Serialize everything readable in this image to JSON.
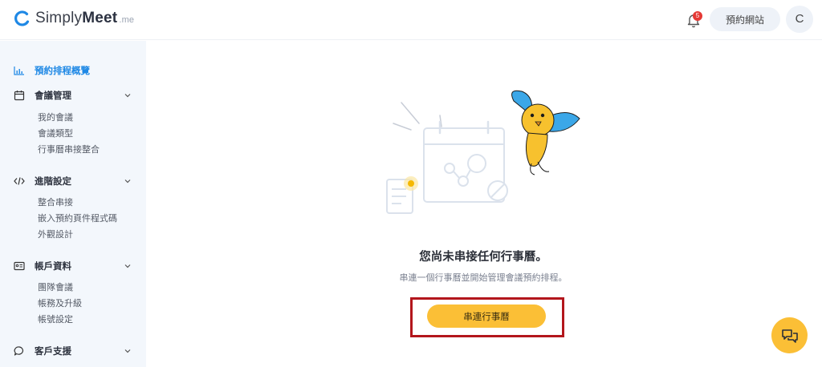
{
  "brand": {
    "name_regular": "Simply",
    "name_bold": "Meet",
    "suffix": ".me",
    "accent": "#1e88e5"
  },
  "header": {
    "notification_count": "5",
    "booking_site_label": "預約網站",
    "avatar_initial": "C"
  },
  "sidebar": {
    "overview": {
      "label": "預約排程概覽",
      "icon": "bar-chart-icon"
    },
    "sections": [
      {
        "label": "會議管理",
        "icon": "calendar-icon",
        "items": [
          "我的會議",
          "會議類型",
          "行事曆串接整合"
        ]
      },
      {
        "label": "進階設定",
        "icon": "code-icon",
        "items": [
          "整合串接",
          "嵌入預約頁件程式碼",
          "外觀設計"
        ]
      },
      {
        "label": "帳戶資料",
        "icon": "id-card-icon",
        "items": [
          "團隊會議",
          "帳務及升級",
          "帳號設定"
        ]
      },
      {
        "label": "客戶支援",
        "icon": "chat-bubble-icon",
        "items": []
      }
    ]
  },
  "main": {
    "empty_title": "您尚未串接任何行事曆。",
    "empty_description": "串連一個行事曆並開始管理會議預約排程。",
    "connect_button_label": "串連行事曆",
    "button_color": "#fbbf36",
    "highlight_color": "#b3161c"
  }
}
